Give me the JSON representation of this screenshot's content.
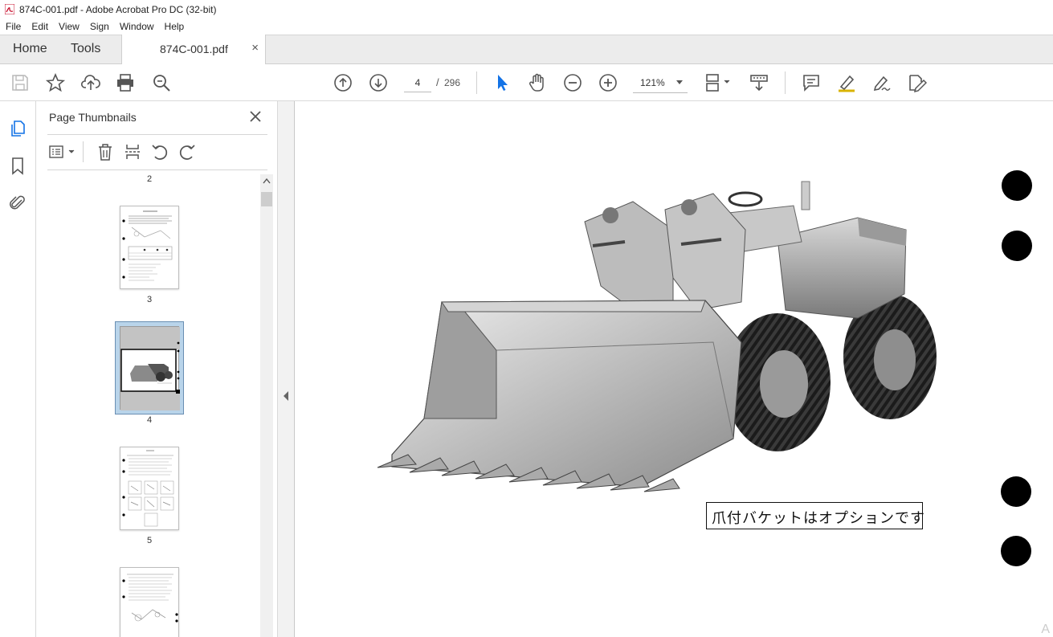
{
  "window": {
    "title": "874C-001.pdf - Adobe Acrobat Pro DC (32-bit)"
  },
  "menu": [
    "File",
    "Edit",
    "View",
    "Sign",
    "Window",
    "Help"
  ],
  "tabs": {
    "home": "Home",
    "tools": "Tools",
    "document": "874C-001.pdf",
    "close": "×"
  },
  "toolbar": {
    "page_current": "4",
    "page_separator": "/",
    "page_total": "296",
    "zoom": "121%"
  },
  "panel": {
    "title": "Page Thumbnails",
    "thumbnails": [
      {
        "label": "2"
      },
      {
        "label": "3"
      },
      {
        "label": "4",
        "selected": true
      },
      {
        "label": "5"
      }
    ]
  },
  "document": {
    "caption": "爪付バケットはオプションです",
    "corner_glyph": "A"
  },
  "colors": {
    "accent": "#1473e6",
    "selected_thumb": "#b9d4ea"
  },
  "icons": [
    "save-icon",
    "bookmark-star-icon",
    "upload-icon",
    "print-icon",
    "search-zoom-icon",
    "prev-page-icon",
    "next-page-icon",
    "select-cursor-icon",
    "hand-icon",
    "zoom-out-icon",
    "zoom-in-icon",
    "page-layout-icon",
    "scroll-mode-icon",
    "comment-icon",
    "highlight-icon",
    "sign-icon",
    "edit-pdf-icon"
  ]
}
